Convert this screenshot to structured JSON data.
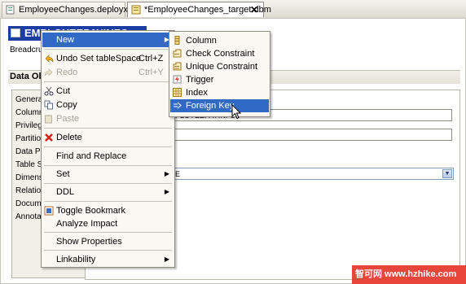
{
  "tabs": [
    {
      "label": "EmployeeChanges.deployxml"
    },
    {
      "label": "*EmployeeChanges_target.dbm",
      "close": "✕"
    }
  ],
  "editor": {
    "title": "EMPLOYEEPAYINFO",
    "breadcrumb": "Breadcrumb",
    "section": "Data Object",
    "properties": [
      "General",
      "Columns",
      "Privileges",
      "Partitions",
      "Data Pa",
      "Table Sp",
      "Dimensi",
      "Relation",
      "Docume",
      "Annotat"
    ],
    "fields": {
      "name_value": "PLOYEEPAYINFO",
      "second_value": "",
      "dropdown_value": "E"
    }
  },
  "context_menu": {
    "items": [
      {
        "label": "New",
        "submenu": true
      },
      {
        "label": "Undo Set tableSpace",
        "shortcut": "Ctrl+Z"
      },
      {
        "label": "Redo",
        "shortcut": "Ctrl+Y",
        "disabled": true
      },
      {
        "label": "Cut"
      },
      {
        "label": "Copy"
      },
      {
        "label": "Paste",
        "disabled": true
      },
      {
        "label": "Delete"
      },
      {
        "label": "Find and Replace"
      },
      {
        "label": "Set",
        "submenu": true
      },
      {
        "label": "DDL",
        "submenu": true
      },
      {
        "label": "Toggle Bookmark"
      },
      {
        "label": "Analyze Impact"
      },
      {
        "label": "Show Properties"
      },
      {
        "label": "Linkability",
        "submenu": true
      }
    ]
  },
  "new_submenu": {
    "items": [
      {
        "label": "Column"
      },
      {
        "label": "Check Constraint"
      },
      {
        "label": "Unique Constraint"
      },
      {
        "label": "Trigger"
      },
      {
        "label": "Index"
      },
      {
        "label": "Foreign Key"
      }
    ]
  },
  "watermark": "智可网 www.hzhike.com",
  "colors": {
    "selection": "#316ac5",
    "title_bar": "#1c3ea4",
    "watermark": "#e8463a"
  }
}
